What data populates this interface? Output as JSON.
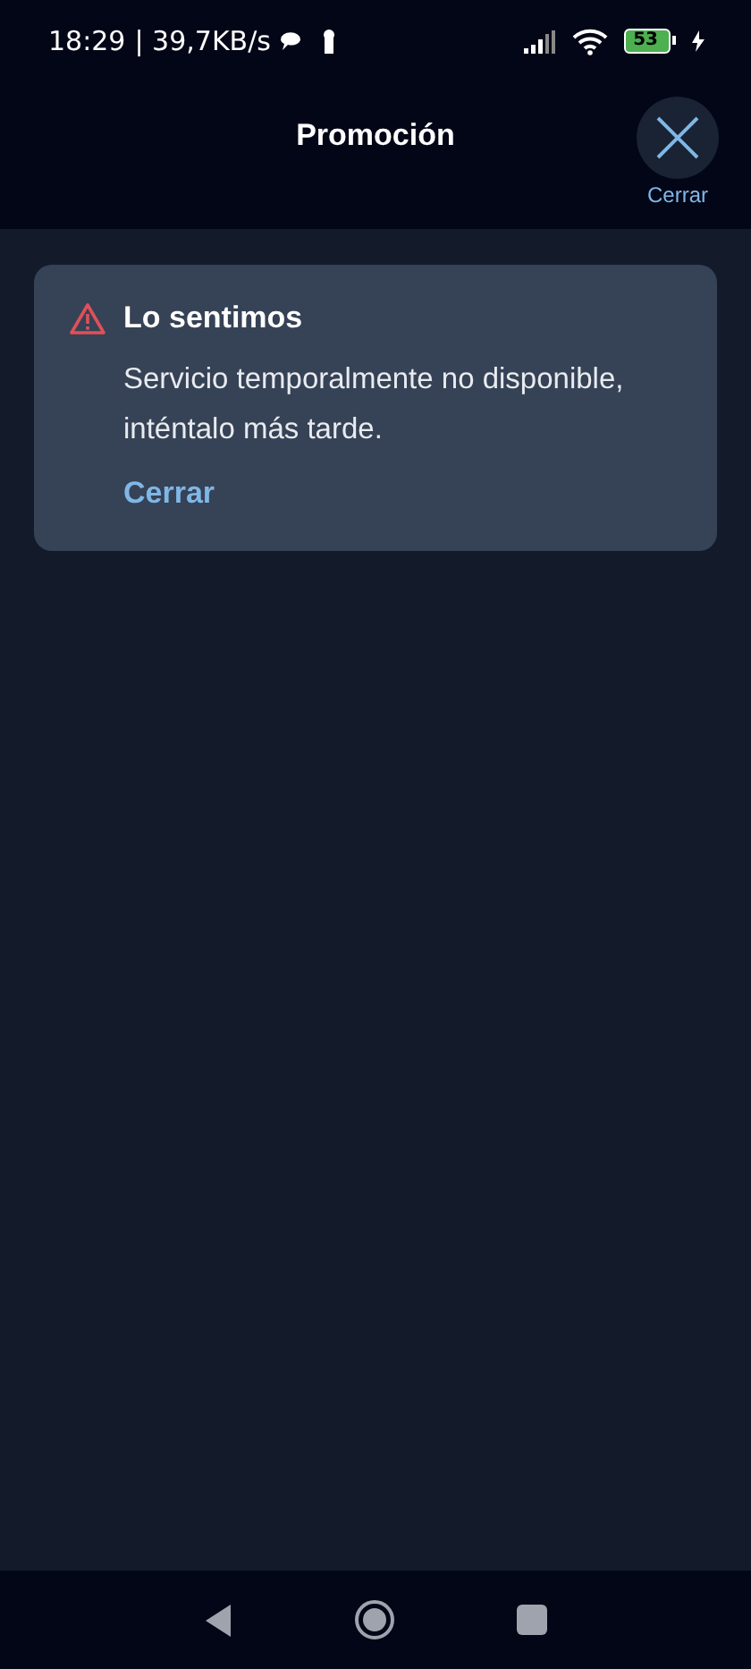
{
  "status_bar": {
    "time": "18:29",
    "speed": "| 39,7KB/s",
    "battery": "53"
  },
  "header": {
    "title": "Promoción",
    "close_label": "Cerrar"
  },
  "alert": {
    "title": "Lo sentimos",
    "message": "Servicio temporalmente no disponible, inténtalo más tarde.",
    "action": "Cerrar"
  }
}
